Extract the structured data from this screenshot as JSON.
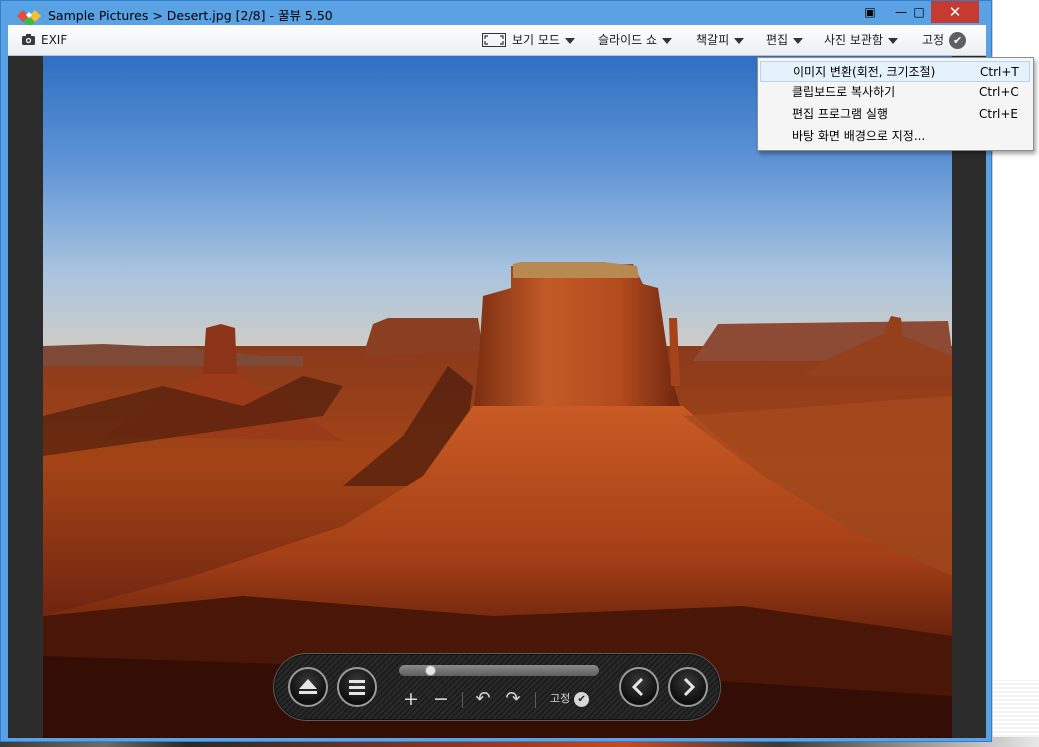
{
  "window": {
    "title": "Sample Pictures > Desert.jpg [2/8] - 꿀뷰 5.50",
    "controls": {
      "pin": "▣",
      "minimize": "—",
      "maximize": "□",
      "close": "✕"
    }
  },
  "toolbar": {
    "exif_label": "EXIF",
    "view_mode_label": "보기 모드",
    "slideshow_label": "슬라이드 쇼",
    "bookmark_label": "책갈피",
    "edit_label": "편집",
    "archive_label": "사진 보관함",
    "pin_label": "고정",
    "check_glyph": "✔"
  },
  "edit_menu": {
    "items": [
      {
        "label": "이미지 변환(회전, 크기조절)",
        "shortcut": "Ctrl+T",
        "highlighted": true
      },
      {
        "label": "클립보드로 복사하기",
        "shortcut": "Ctrl+C"
      },
      {
        "label": "편집 프로그램 실행",
        "shortcut": "Ctrl+E"
      },
      {
        "label": "바탕 화면 배경으로 지정...",
        "shortcut": ""
      }
    ]
  },
  "controlbar": {
    "zoom_in_glyph": "+",
    "zoom_out_glyph": "−",
    "rotate_left_glyph": "↶",
    "rotate_right_glyph": "↷",
    "pin_label": "고정",
    "check_glyph": "✔",
    "progress_fraction": 0.14
  },
  "colors": {
    "titlebar": "#5aa2e4",
    "close_button": "#c73a2f",
    "menu_highlight": "#e5f1fb"
  },
  "icons": {
    "app": "kkulview-diamond-icon",
    "exif": "camera-icon",
    "view_mode": "fullscreen-frame-icon",
    "eject": "eject-icon",
    "menu": "hamburger-icon",
    "prev": "chevron-left-icon",
    "next": "chevron-right-icon"
  }
}
